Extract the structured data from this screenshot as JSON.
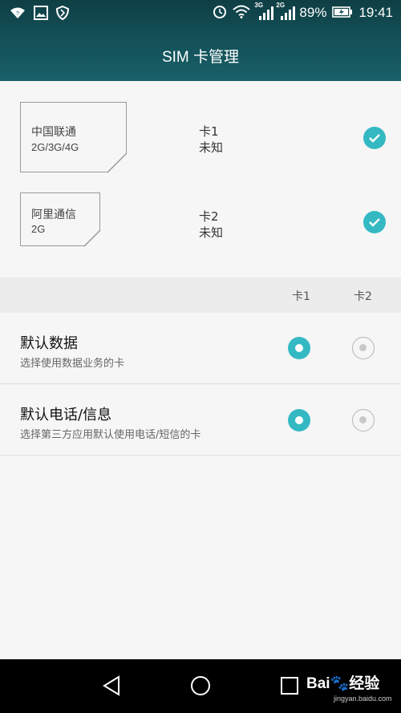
{
  "status_bar": {
    "network_1": "3G",
    "network_2": "2G",
    "battery": "89%",
    "time": "19:41"
  },
  "title": "SIM 卡管理",
  "sims": [
    {
      "carrier": "中国联通",
      "bands": "2G/3G/4G",
      "slot": "卡1",
      "status": "未知",
      "enabled": true
    },
    {
      "carrier": "阿里通信",
      "bands": "2G",
      "slot": "卡2",
      "status": "未知",
      "enabled": true
    }
  ],
  "columns": {
    "card1": "卡1",
    "card2": "卡2"
  },
  "settings": [
    {
      "title": "默认数据",
      "subtitle": "选择使用数据业务的卡",
      "selected": "卡1"
    },
    {
      "title": "默认电话/信息",
      "subtitle": "选择第三方应用默认使用电话/短信的卡",
      "selected": "卡1"
    }
  ],
  "watermark": {
    "brand": "Bai",
    "brand_suffix": "经验",
    "url": "jingyan.baidu.com"
  },
  "colors": {
    "accent": "#34b9c3",
    "header": "#14525a"
  },
  "icons": [
    "wifi-icon",
    "image-icon",
    "shield-icon",
    "alarm-icon",
    "battery-icon",
    "back-icon",
    "home-icon",
    "recents-icon"
  ]
}
